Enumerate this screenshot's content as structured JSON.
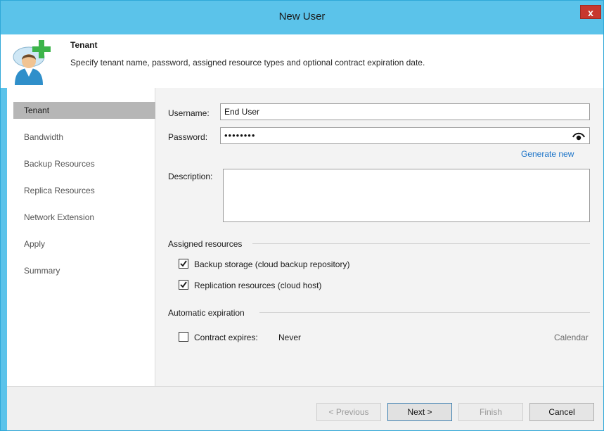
{
  "window": {
    "title": "New User",
    "close_glyph": "x"
  },
  "header": {
    "title": "Tenant",
    "description": "Specify tenant name, password, assigned resource types and optional contract expiration date.",
    "icon": "tenant-add-user-icon"
  },
  "sidebar": {
    "items": [
      {
        "label": "Tenant",
        "active": true
      },
      {
        "label": "Bandwidth"
      },
      {
        "label": "Backup Resources"
      },
      {
        "label": "Replica Resources"
      },
      {
        "label": "Network Extension"
      },
      {
        "label": "Apply"
      },
      {
        "label": "Summary"
      }
    ]
  },
  "form": {
    "username_label": "Username:",
    "username_value": "End User",
    "password_label": "Password:",
    "password_value": "••••••••",
    "generate_new": "Generate new",
    "description_label": "Description:",
    "description_value": "",
    "assigned_resources_heading": "Assigned resources",
    "backup_storage_label": "Backup storage (cloud backup repository)",
    "backup_storage_checked": true,
    "replication_label": "Replication resources (cloud host)",
    "replication_checked": true,
    "automatic_expiration_heading": "Automatic expiration",
    "contract_expires_label": "Contract expires:",
    "contract_expires_checked": false,
    "contract_expires_value": "Never",
    "calendar_label": "Calendar"
  },
  "footer": {
    "previous": "< Previous",
    "next": "Next >",
    "finish": "Finish",
    "cancel": "Cancel"
  },
  "colors": {
    "titlebar": "#5bc3ea",
    "close": "#c7372e",
    "link": "#1a73c8",
    "icon_green": "#3cb44a"
  }
}
